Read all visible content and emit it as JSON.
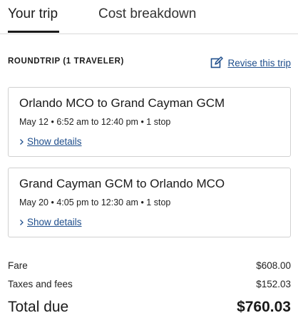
{
  "tabs": {
    "your_trip": "Your trip",
    "cost_breakdown": "Cost breakdown",
    "active": "your_trip"
  },
  "summary": {
    "heading": "ROUNDTRIP (1 TRAVELER)",
    "revise_label": "Revise this trip",
    "revise_icon": "edit-icon"
  },
  "flights": [
    {
      "title": "Orlando MCO to Grand Cayman GCM",
      "details": "May 12 • 6:52 am to 12:40 pm • 1 stop",
      "show_details": "Show details"
    },
    {
      "title": "Grand Cayman GCM to Orlando MCO",
      "details": "May 20 • 4:05 pm to 12:30 am • 1 stop",
      "show_details": "Show details"
    }
  ],
  "costs": {
    "fare_label": "Fare",
    "fare_value": "$608.00",
    "taxes_label": "Taxes and fees",
    "taxes_value": "$152.03",
    "total_label": "Total due",
    "total_value": "$760.03"
  },
  "colors": {
    "link": "#1f4e8c",
    "text": "#1a1a1a",
    "border": "#d0d0d0"
  }
}
